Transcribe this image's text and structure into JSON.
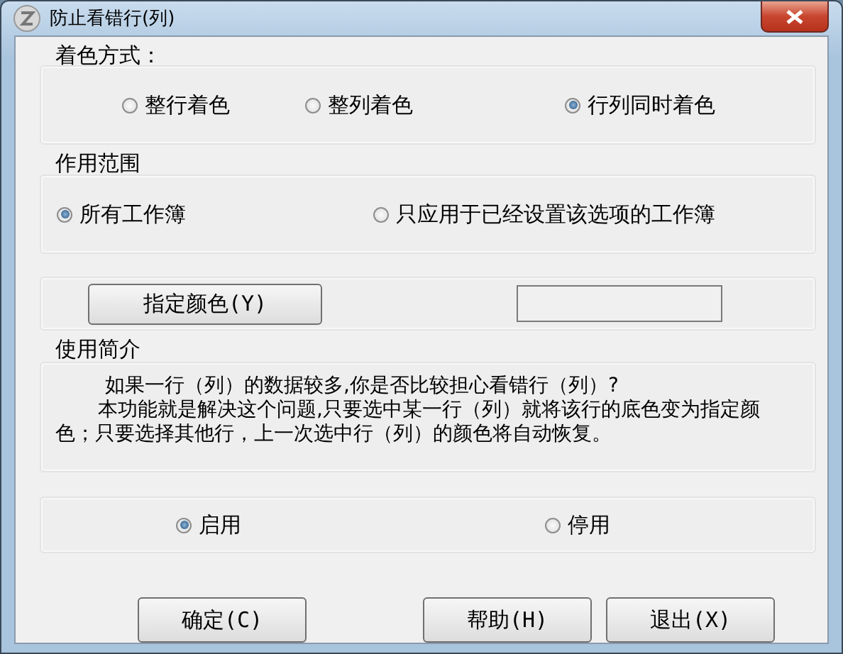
{
  "window": {
    "title": "防止看错行(列)"
  },
  "color_mode": {
    "label": "着色方式：",
    "options": [
      {
        "label": "整行着色",
        "selected": false
      },
      {
        "label": "整列着色",
        "selected": false
      },
      {
        "label": "行列同时着色",
        "selected": true
      }
    ]
  },
  "scope": {
    "label": "作用范围",
    "options": [
      {
        "label": "所有工作簿",
        "selected": true
      },
      {
        "label": "只应用于已经设置该选项的工作簿",
        "selected": false
      }
    ]
  },
  "color_button": "指定颜色(Y)",
  "intro": {
    "label": "使用简介",
    "paragraphs": [
      "如果一行（列）的数据较多,你是否比较担心看错行（列）?",
      "本功能就是解决这个问题,只要选中某一行（列）就将该行的底色变为指定颜色；只要选择其他行，上一次选中行（列）的颜色将自动恢复。"
    ]
  },
  "enable": {
    "options": [
      {
        "label": "启用",
        "selected": true
      },
      {
        "label": "停用",
        "selected": false
      }
    ]
  },
  "buttons": [
    "确定(C)",
    "帮助(H)",
    "退出(X)"
  ]
}
